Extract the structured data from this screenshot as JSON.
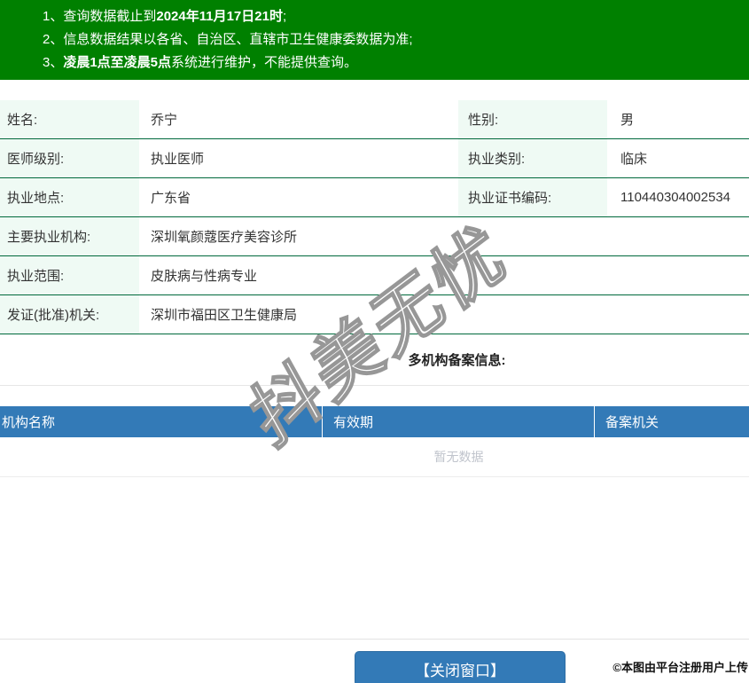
{
  "notices": {
    "items": [
      {
        "num": "1、",
        "pre": "查询数据截止到",
        "bold": "2024年11月17日21时",
        "post": ";"
      },
      {
        "num": "2、",
        "pre": "信息数据结果以各省、自治区、直辖市卫生健康委数据为准;",
        "bold": "",
        "post": ""
      },
      {
        "num": "3、",
        "pre": "",
        "bold": "凌晨1点至凌晨5点",
        "post": "系统进行维护，不能提供查询。"
      }
    ]
  },
  "doctor": {
    "name_label": "姓名:",
    "name": "乔宁",
    "gender_label": "性别:",
    "gender": "男",
    "level_label": "医师级别:",
    "level": "执业医师",
    "category_label": "执业类别:",
    "category": "临床",
    "location_label": "执业地点:",
    "location": "广东省",
    "cert_no_label": "执业证书编码:",
    "cert_no": "110440304002534",
    "main_org_label": "主要执业机构:",
    "main_org": "深圳氧颜蔻医疗美容诊所",
    "scope_label": "执业范围:",
    "scope": "皮肤病与性病专业",
    "issuer_label": "发证(批准)机关:",
    "issuer": "深圳市福田区卫生健康局"
  },
  "records": {
    "section_title": "多机构备案信息:",
    "columns": [
      "机构名称",
      "有效期",
      "备案机关"
    ],
    "empty_text": "暂无数据"
  },
  "footer": {
    "close_button": "【关闭窗口】",
    "copyright": "©本图由平台注册用户上传"
  },
  "watermark": "抖美无忧",
  "colors": {
    "banner-green": "#008000",
    "row-line-green": "#00693c",
    "label-mint": "#effaf4",
    "header-blue": "#337ab7",
    "button-border": "#2e6da4",
    "soft-line": "#e6e6e6",
    "empty-gray": "#c0c4cc",
    "text-dark": "#333333"
  }
}
